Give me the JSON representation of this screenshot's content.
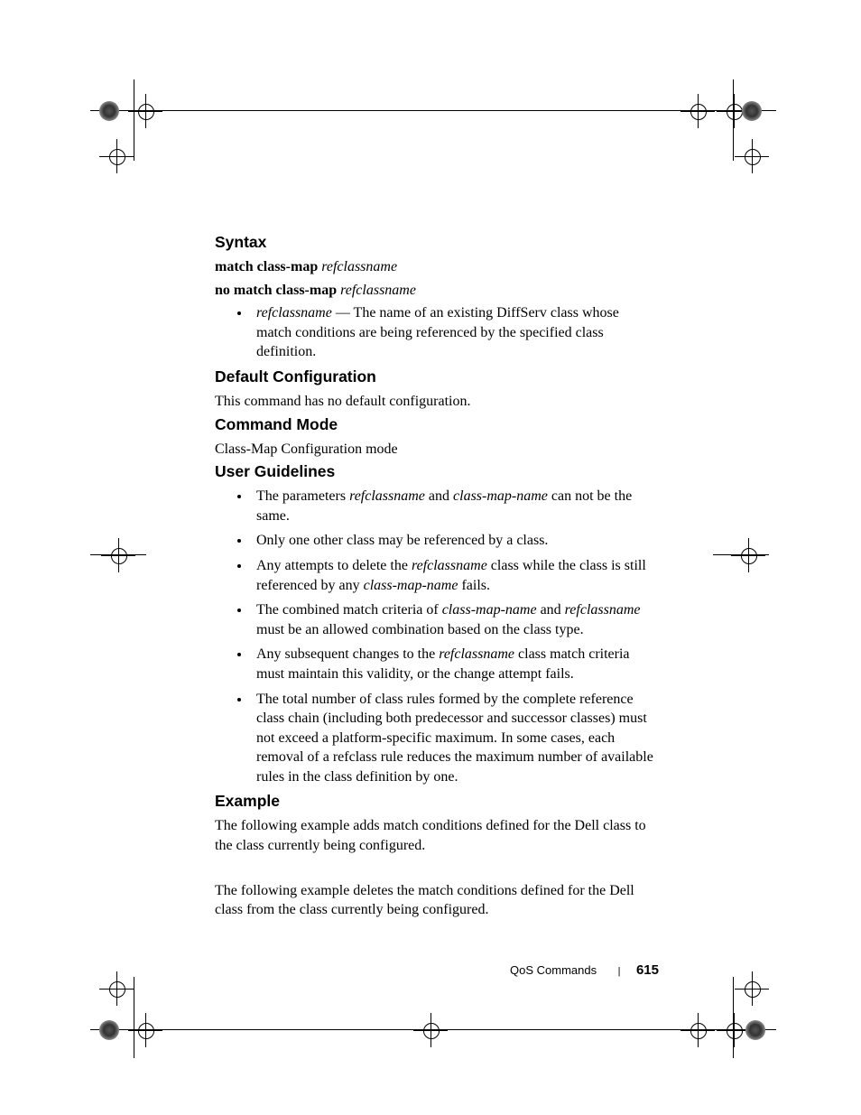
{
  "sections": {
    "syntax": {
      "heading": "Syntax",
      "line1_bold": "match class-map ",
      "line1_ital": "refclassname",
      "line2_bold": "no match class-map ",
      "line2_ital": "refclassname",
      "bullet_ital": "refclassname ",
      "bullet_rest": "— The name of an existing DiffServ class whose match conditions are being referenced by the specified class definition."
    },
    "default_config": {
      "heading": "Default Configuration",
      "body": "This command has no default configuration."
    },
    "command_mode": {
      "heading": "Command Mode",
      "body": "Class-Map Configuration mode"
    },
    "guidelines": {
      "heading": "User Guidelines",
      "b1_a": "The parameters ",
      "b1_i1": "refclassname",
      "b1_b": " and ",
      "b1_i2": "class-map-name",
      "b1_c": " can not be the same.",
      "b2": "Only one other class may be referenced by a class.",
      "b3_a": "Any attempts to delete the ",
      "b3_i1": "refclassname",
      "b3_b": " class while the class is still referenced by any ",
      "b3_i2": "class-map-name",
      "b3_c": " fails.",
      "b4_a": "The combined match criteria of ",
      "b4_i1": "class-map-name",
      "b4_b": " and ",
      "b4_i2": "refclassname",
      "b4_c": " must be an allowed combination based on the class type.",
      "b5_a": "Any subsequent changes to the ",
      "b5_i1": "refclassname",
      "b5_b": " class match criteria must maintain this validity, or the change attempt fails.",
      "b6": "The total number of class rules formed by the complete reference class chain (including both predecessor and successor classes) must not exceed a platform-specific maximum. In some cases, each removal of a refclass rule reduces the maximum number of available rules in the class definition by one."
    },
    "example": {
      "heading": "Example",
      "p1": "The following example adds match conditions defined for the Dell class to the class currently being configured.",
      "p2": "The following example deletes the match conditions defined for the Dell class from the class currently being configured."
    }
  },
  "footer": {
    "section": "QoS Commands",
    "sep": "|",
    "page": "615"
  }
}
